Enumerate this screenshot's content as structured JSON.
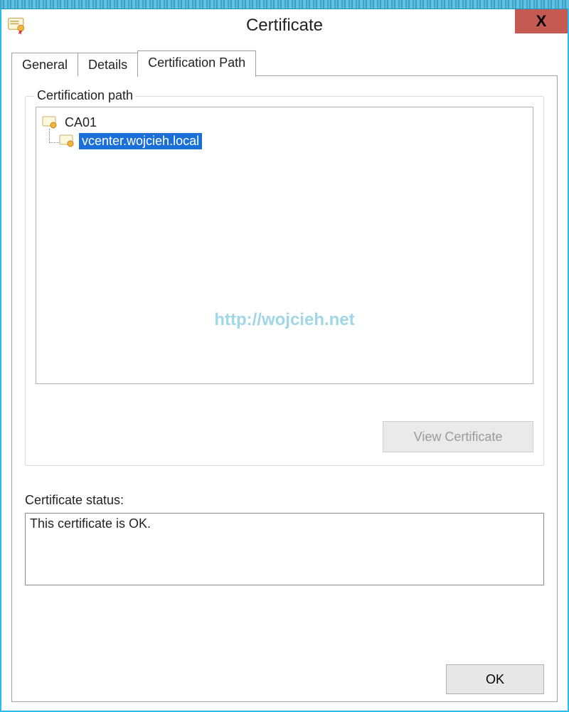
{
  "window": {
    "title": "Certificate",
    "close_label": "X"
  },
  "tabs": {
    "general": "General",
    "details": "Details",
    "cert_path": "Certification Path"
  },
  "groupbox": {
    "label": "Certification path"
  },
  "tree": {
    "root": "CA01",
    "child": "vcenter.wojcieh.local"
  },
  "watermark": "http://wojcieh.net",
  "buttons": {
    "view_certificate": "View Certificate",
    "ok": "OK"
  },
  "status": {
    "label": "Certificate status:",
    "text": "This certificate is OK."
  }
}
